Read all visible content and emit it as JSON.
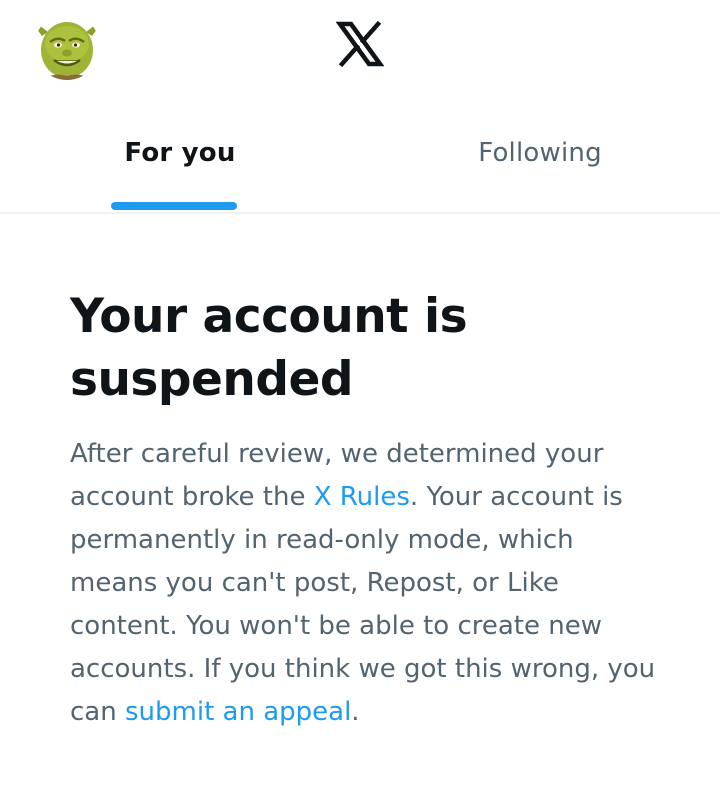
{
  "header": {
    "avatar_icon": "shrek-avatar-icon",
    "logo_icon": "x-logo-icon"
  },
  "tabs": [
    {
      "label": "For you",
      "active": true
    },
    {
      "label": "Following",
      "active": false
    }
  ],
  "notice": {
    "title": "Your account is suspended",
    "body_part1": "After careful review, we determined your account broke the ",
    "rules_link": "X Rules",
    "body_part2": ". Your account is permanently in read-only mode, which means you can't post, Repost, or Like content. You won't be able to create new accounts. If you think we got this wrong, you can ",
    "appeal_link": "submit an appeal",
    "body_part3": "."
  },
  "colors": {
    "accent": "#1d9bf0",
    "text_primary": "#0f1419",
    "text_secondary": "#536471",
    "divider": "#eff3f4"
  }
}
